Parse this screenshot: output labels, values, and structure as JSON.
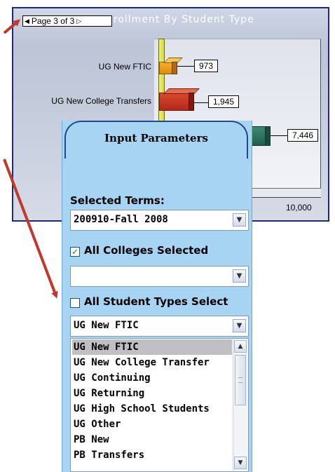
{
  "chart": {
    "title": "nrollment By Student Type",
    "pager": {
      "prev_icon": "triangle-left",
      "label": "Page 3 of 3",
      "next_icon": "triangle-right"
    },
    "tick_label": "10,000"
  },
  "chart_data": {
    "type": "bar",
    "orientation": "horizontal",
    "title": "nrollment By Student Type",
    "categories": [
      "UG New FTIC",
      "UG New College Transfers",
      ""
    ],
    "values": [
      973,
      1945,
      7446
    ],
    "value_labels": [
      "973",
      "1,945",
      "7,446"
    ],
    "xlim": [
      0,
      10000
    ],
    "x_ticks": [
      "10,000"
    ],
    "colors": [
      "#f0a020",
      "#c0341e",
      "#2a6a58"
    ]
  },
  "panel": {
    "title": "Input Parameters",
    "selected_terms_label": "Selected Terms:",
    "term_value": "200910-Fall 2008",
    "all_colleges": {
      "label": "All Colleges Selected",
      "checked": true
    },
    "college_value": "",
    "all_student_types": {
      "label": "All Student Types Select",
      "checked": false
    },
    "student_type_value": "UG New FTIC",
    "student_type_options": [
      "UG New FTIC",
      "UG New College Transfer",
      "UG Continuing",
      "UG Returning",
      "UG High School Students",
      "UG Other",
      "PB New",
      "PB Transfers"
    ],
    "selected_option": "UG New FTIC"
  },
  "colors": {
    "annotation_arrow": "#c0392b",
    "panel_bg": "#a8d4f4",
    "frame_border": "#1e2a78"
  }
}
